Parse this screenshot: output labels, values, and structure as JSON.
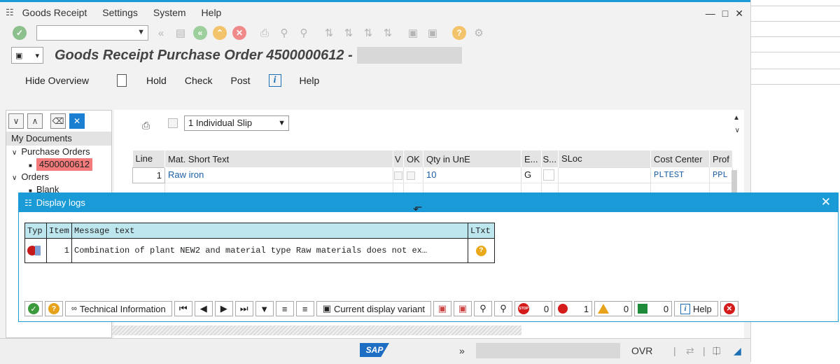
{
  "menubar": {
    "items": [
      "Goods Receipt",
      "Settings",
      "System",
      "Help"
    ]
  },
  "title": {
    "main": "Goods Receipt Purchase Order 4500000612 -"
  },
  "app_toolbar": {
    "hide_overview": "Hide Overview",
    "hold": "Hold",
    "check": "Check",
    "post": "Post",
    "help": "Help"
  },
  "tree": {
    "header": "My Documents",
    "purchase_orders": "Purchase Orders",
    "po_number": "4500000612",
    "orders": "Orders",
    "blank": "Blank"
  },
  "slip": {
    "selected": "1 Individual Slip"
  },
  "po_table": {
    "headers": [
      "Line",
      "Mat. Short Text",
      "V",
      "OK",
      "Qty in UnE",
      "E...",
      "S...",
      "SLoc",
      "Cost Center",
      "Prof"
    ],
    "row": {
      "line": "1",
      "mat_text": "Raw iron",
      "qty": "10",
      "unit": "G",
      "cost_center": "PLTEST",
      "profit": "PPL"
    }
  },
  "dialog": {
    "title": "Display logs",
    "headers": [
      "Typ",
      "Item",
      "Message text",
      "LTxt"
    ],
    "row": {
      "item": "1",
      "message": "Combination of plant NEW2 and material type Raw materials does not ex…"
    },
    "toolbar": {
      "technical_info": "Technical Information",
      "display_variant": "Current display variant",
      "help": "Help",
      "counts": {
        "stop": "0",
        "error": "1",
        "warning": "0",
        "success": "0"
      }
    }
  },
  "statusbar": {
    "sap": "SAP",
    "ovr": "OVR",
    "chevron": "»"
  },
  "colors": {
    "accent": "#1a9bd7",
    "selected_po": "#f37b7b",
    "error": "#d41c1c",
    "warning": "#e6a21a",
    "success": "#1d8a3a"
  }
}
